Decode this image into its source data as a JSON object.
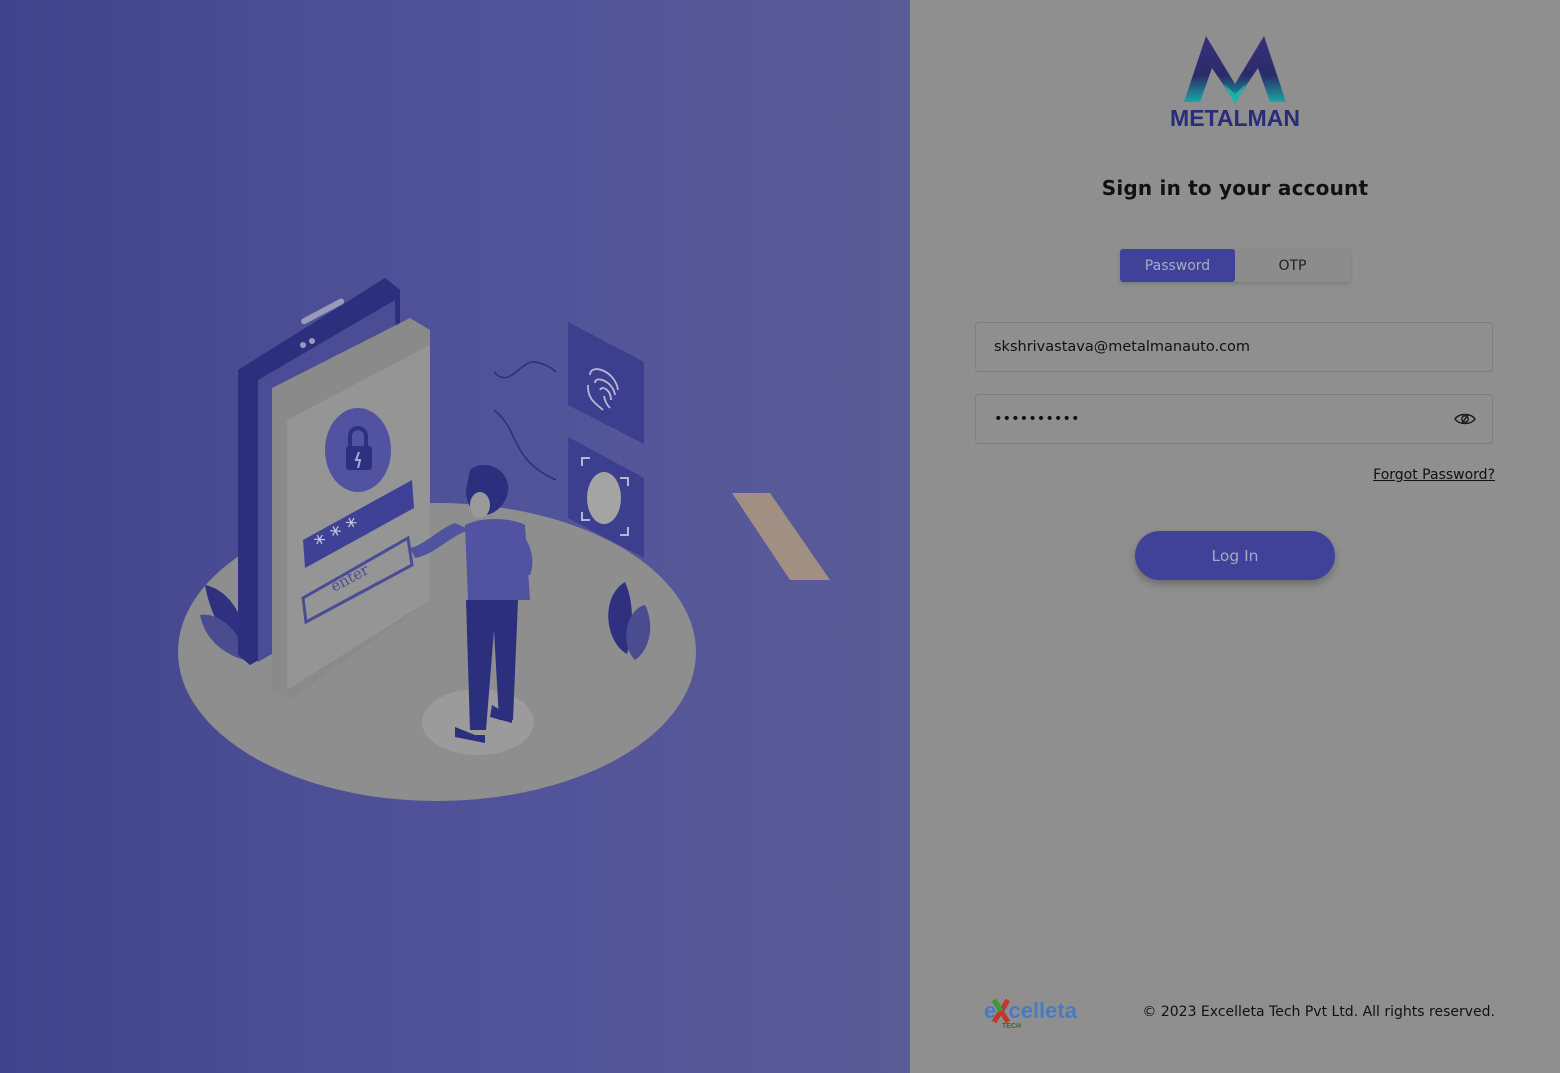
{
  "brand": {
    "logo_text": "METALMAN",
    "colors": {
      "primary": "#40429a",
      "logo_teal": "#1aa6a0",
      "logo_navy": "#2a2c6a"
    }
  },
  "login": {
    "title": "Sign in to your account",
    "tabs": [
      {
        "label": "Password",
        "active": true
      },
      {
        "label": "OTP",
        "active": false
      }
    ],
    "email_value": "skshrivastava@metalmanauto.com",
    "password_value": "••••••••••",
    "password_toggle_icon": "eye-icon",
    "forgot_label": "Forgot Password?",
    "login_label": "Log In"
  },
  "footer": {
    "company_logo_text": "excelleta",
    "company_logo_subtext": "TECH",
    "copyright": "© 2023 Excelleta Tech Pvt Ltd. All rights reserved."
  },
  "illustration": {
    "subject": "person-unlocking-phone-illustration",
    "phone_button_text": "enter",
    "icons": [
      "lock-icon",
      "fingerprint-icon",
      "face-id-icon"
    ]
  }
}
